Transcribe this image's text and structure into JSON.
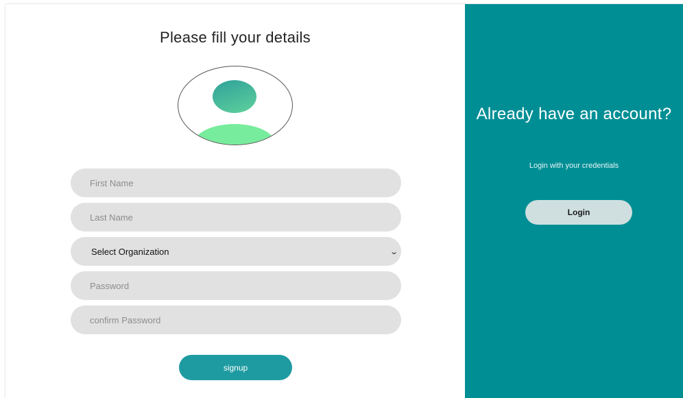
{
  "signup_form": {
    "title": "Please fill your details",
    "fields": {
      "first_name": {
        "value": "",
        "placeholder": "First Name"
      },
      "last_name": {
        "value": "",
        "placeholder": "Last Name"
      },
      "organization": {
        "selected": "Select Organization"
      },
      "password": {
        "value": "",
        "placeholder": "Password"
      },
      "confirm_password": {
        "value": "",
        "placeholder": "confirm Password"
      }
    },
    "signup_label": "signup"
  },
  "login_panel": {
    "title": "Already have an account?",
    "subtitle": "Login with your credentials",
    "login_label": "Login"
  },
  "colors": {
    "teal_panel": "#008e95",
    "button_teal": "#1e9ba1",
    "field_gray": "#e1e1e1",
    "avatar_green": "#77ec9d"
  },
  "icons": {
    "avatar": "user-avatar-icon",
    "dropdown": "chevron-down-icon"
  }
}
